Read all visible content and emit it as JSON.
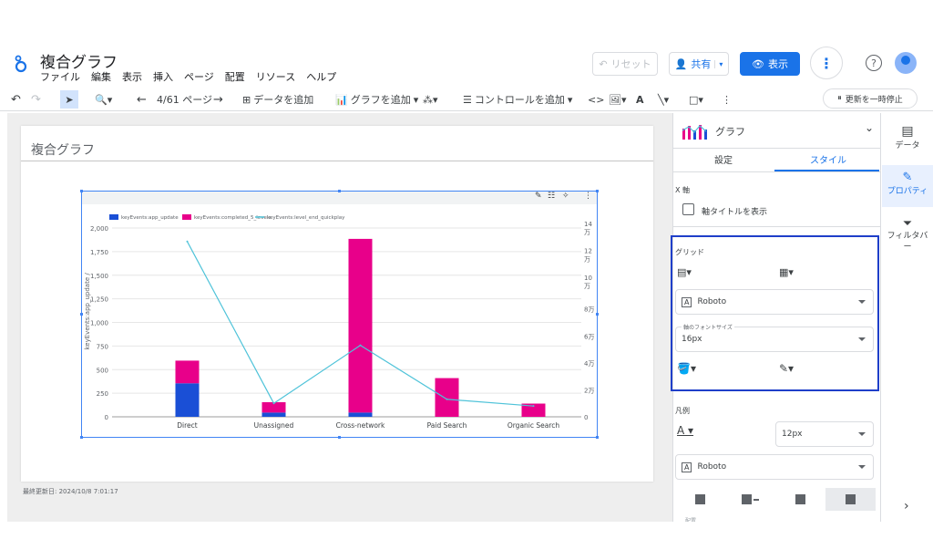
{
  "app": {
    "title": "複合グラフ",
    "menu": [
      "ファイル",
      "編集",
      "表示",
      "挿入",
      "ページ",
      "配置",
      "リソース",
      "ヘルプ"
    ],
    "reset_label": "リセット",
    "share_label": "共有",
    "view_label": "表示",
    "help_label": "?"
  },
  "toolbar": {
    "page_indicator": "4/61 ページ",
    "add_data": "データを追加",
    "add_chart": "グラフを追加",
    "add_control": "コントロールを追加",
    "pause_updates": "更新を一時停止"
  },
  "report": {
    "page_title": "複合グラフ",
    "last_updated": "最終更新日: 2024/10/8 7:01:17"
  },
  "chart_data": {
    "type": "bar",
    "categories": [
      "Direct",
      "Unassigned",
      "Cross-network",
      "Paid Search",
      "Organic Search"
    ],
    "series": [
      {
        "name": "keyEvents:app_update",
        "type": "bar",
        "axis": "left",
        "color": "#1a4fd6",
        "values": [
          355,
          45,
          45,
          0,
          0
        ]
      },
      {
        "name": "keyEvents:completed_5_levels",
        "type": "bar",
        "axis": "left",
        "color": "#e8008a",
        "values": [
          240,
          110,
          1840,
          410,
          140
        ]
      },
      {
        "name": "keyEvents:level_end_quickplay",
        "type": "line",
        "axis": "right",
        "color": "#4fc3d9",
        "values": [
          130000,
          10000,
          53000,
          13000,
          8000
        ]
      }
    ],
    "ylabel": "keyEvents:app_update /",
    "ylim": [
      0,
      2000
    ],
    "y_ticks": [
      "0",
      "250",
      "500",
      "750",
      "1,000",
      "1,250",
      "1,500",
      "1,750",
      "2,000"
    ],
    "y2lim": [
      0,
      140000
    ],
    "y2_ticks": [
      "0",
      "2万",
      "4万",
      "6万",
      "8万",
      "10\n万",
      "12\n万",
      "14\n万"
    ],
    "stacked": true,
    "grid": true,
    "legend_position": "top-left"
  },
  "panel": {
    "chart_type_label": "グラフ",
    "tab_setup": "設定",
    "tab_style": "スタイル",
    "x_axis_section": "X 軸",
    "show_axis_title": "軸タイトルを表示",
    "grid_section": "グリッド",
    "font_family": "Roboto",
    "axis_font_size_label": "軸のフォントサイズ",
    "axis_font_size": "16px",
    "legend_section": "凡例",
    "legend_font_size": "12px",
    "legend_font_family": "Roboto",
    "next_section_partial": "配置"
  },
  "rail": {
    "data": "データ",
    "properties": "プロパティ",
    "filter_bar": "フィルタバー"
  },
  "colors": {
    "accent": "#1a73e8",
    "highlight_border": "#1f3fc9"
  }
}
